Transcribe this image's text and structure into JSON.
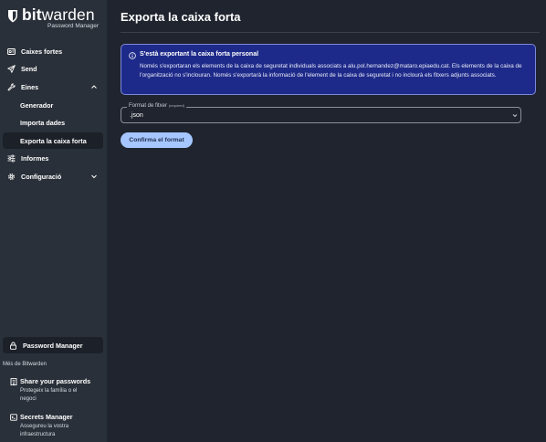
{
  "brand": {
    "name_bold": "bit",
    "name_regular": "warden",
    "subtitle": "Password Manager"
  },
  "sidebar": {
    "items": [
      {
        "label": "Caixes fortes",
        "icon": "vault-icon"
      },
      {
        "label": "Send",
        "icon": "send-icon"
      },
      {
        "label": "Eines",
        "icon": "wrench-icon",
        "expanded": true
      },
      {
        "label": "Generador"
      },
      {
        "label": "Importa dades"
      },
      {
        "label": "Exporta la caixa forta",
        "active": true
      },
      {
        "label": "Informes",
        "icon": "sliders-icon"
      },
      {
        "label": "Configuració",
        "icon": "gear-icon",
        "expanded": false
      }
    ],
    "product_switcher_label": "Password Manager",
    "more_from_label": "Més de Bitwarden",
    "promos": [
      {
        "title": "Share your passwords",
        "description": "Protegeix la família o el negoci",
        "icon": "building-icon"
      },
      {
        "title": "Secrets Manager",
        "description": "Assegureu la vostra infraestructura",
        "icon": "terminal-icon"
      }
    ]
  },
  "main": {
    "title": "Exporta la caixa forta",
    "callout": {
      "title": "S'està exportant la caixa forta personal",
      "body": "Només s'exportaran els elements de la caixa de seguretat individuals associats a alu.pol.hernandez@mataro.epiaedu.cat. Els elements de la caixa de l'organització no s'inclouran. Només s'exportarà la informació de l'element de la caixa de seguretat i no inclourà els fitxers adjunts associats."
    },
    "format_field": {
      "label": "Format de fitxer",
      "required_note": "(required)",
      "value": ".json"
    },
    "confirm_button": "Confirma el format"
  },
  "colors": {
    "sidebar_bg": "#2a3039",
    "main_bg": "#1f242e",
    "callout_bg": "#1e2a8a",
    "primary_button": "#a6c6ff"
  }
}
